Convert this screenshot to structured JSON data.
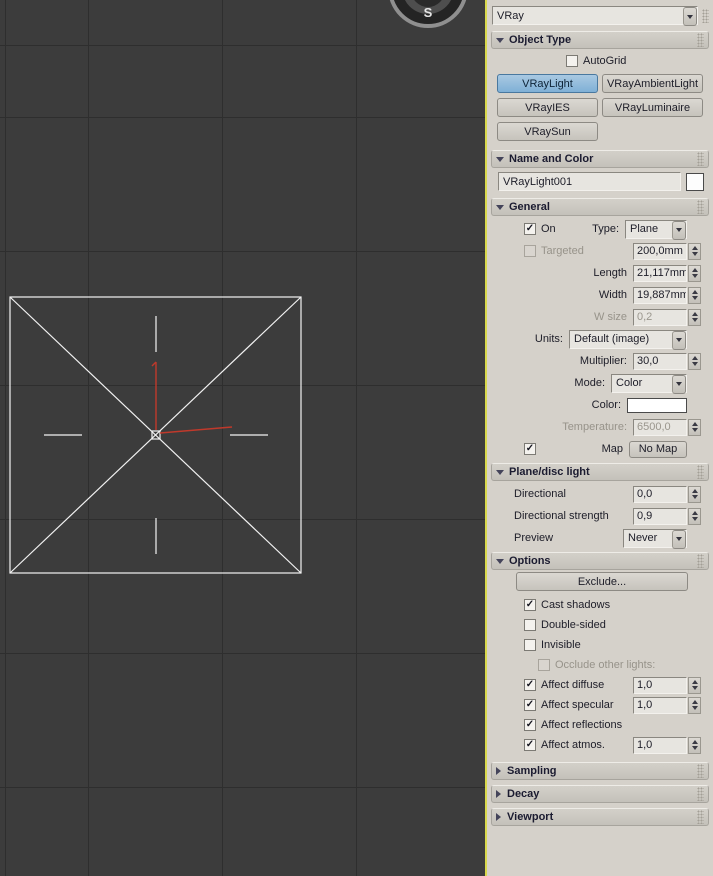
{
  "colors": {
    "panel": "#d5d1ca",
    "accent": "#7fb0d6",
    "field": "#e7e5e0",
    "viewport-bg": "#3c3c3c",
    "grid-line": "#2e2e2e",
    "divider": "#d8d84c",
    "light-line": "#f2f2f2",
    "axis-red": "#c0392b"
  },
  "top": {
    "category_value": "VRay"
  },
  "viewport": {
    "sun_label": "S"
  },
  "object_type": {
    "title": "Object Type",
    "autogrid_label": "AutoGrid",
    "buttons": {
      "vraylight": "VRayLight",
      "vrayambientlight": "VRayAmbientLight",
      "vrayies": "VRayIES",
      "vrayluminaire": "VRayLuminaire",
      "vraysun": "VRaySun"
    },
    "active_button": "VRayLight"
  },
  "name_color": {
    "title": "Name and Color",
    "name_value": "VRayLight001"
  },
  "general": {
    "title": "General",
    "on_label": "On",
    "type_label": "Type:",
    "type_value": "Plane",
    "targeted_label": "Targeted",
    "targeted_value": "200,0mm",
    "length_label": "Length",
    "length_value": "21,117mm",
    "width_label": "Width",
    "width_value": "19,887mm",
    "wsize_label": "W size",
    "wsize_value": "0,2",
    "units_label": "Units:",
    "units_value": "Default (image)",
    "multiplier_label": "Multiplier:",
    "multiplier_value": "30,0",
    "mode_label": "Mode:",
    "mode_value": "Color",
    "color_label": "Color:",
    "temperature_label": "Temperature:",
    "temperature_value": "6500,0",
    "map_label": "Map",
    "map_button": "No Map"
  },
  "plane_disc": {
    "title": "Plane/disc light",
    "directional_label": "Directional",
    "directional_value": "0,0",
    "strength_label": "Directional strength",
    "strength_value": "0,9",
    "preview_label": "Preview",
    "preview_value": "Never"
  },
  "options": {
    "title": "Options",
    "exclude_button": "Exclude...",
    "cast_shadows_label": "Cast shadows",
    "double_sided_label": "Double-sided",
    "invisible_label": "Invisible",
    "occlude_label": "Occlude other lights:",
    "affect_diffuse_label": "Affect diffuse",
    "affect_diffuse_value": "1,0",
    "affect_specular_label": "Affect specular",
    "affect_specular_value": "1,0",
    "affect_reflections_label": "Affect reflections",
    "affect_atmos_label": "Affect atmos.",
    "affect_atmos_value": "1,0"
  },
  "collapsed": {
    "sampling": "Sampling",
    "decay": "Decay",
    "viewport": "Viewport"
  },
  "checks": {
    "autogrid": false,
    "on": true,
    "targeted": false,
    "map": true,
    "cast_shadows": true,
    "double_sided": false,
    "invisible": false,
    "occlude": false,
    "affect_diffuse": true,
    "affect_specular": true,
    "affect_reflections": true,
    "affect_atmos": true
  }
}
